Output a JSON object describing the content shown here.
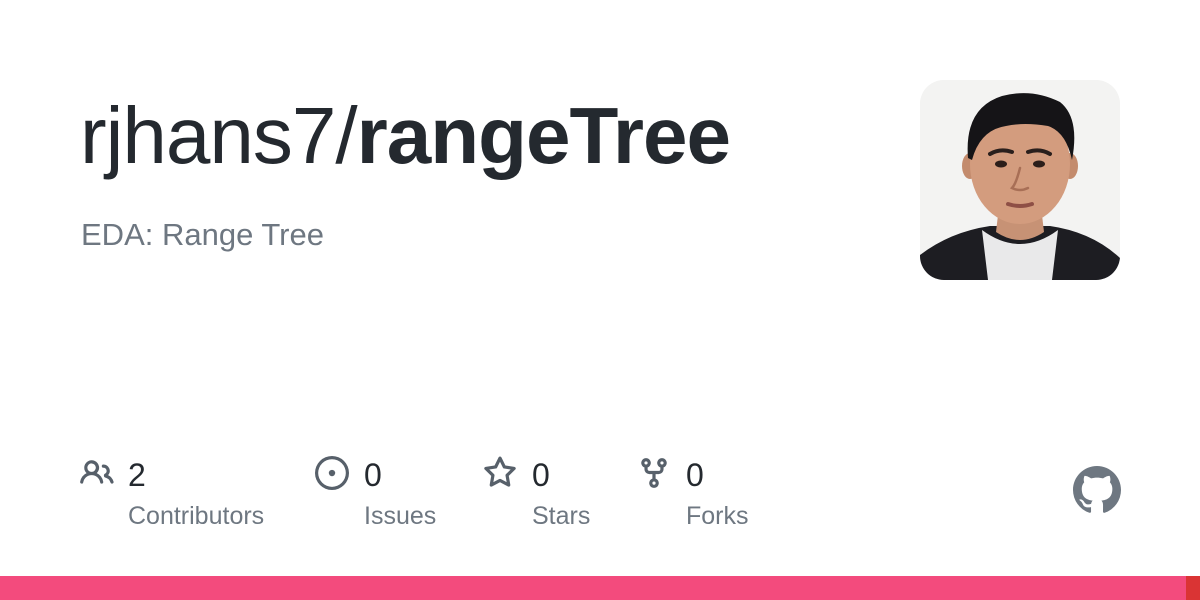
{
  "repo": {
    "owner": "rjhans7/",
    "name": "rangeTree",
    "description": "EDA: Range Tree"
  },
  "stats": [
    {
      "icon": "people-icon",
      "value": "2",
      "label": "Contributors"
    },
    {
      "icon": "issue-opened-icon",
      "value": "0",
      "label": "Issues"
    },
    {
      "icon": "star-icon",
      "value": "0",
      "label": "Stars"
    },
    {
      "icon": "repo-forked-icon",
      "value": "0",
      "label": "Forks"
    }
  ],
  "colors": {
    "text_primary": "#24292f",
    "text_secondary": "#6e7781",
    "icon": "#57606a",
    "github_logo": "#6e7781",
    "language_bar": [
      "#f34b7d",
      "#da3434"
    ]
  },
  "language_bar": [
    {
      "color": "#f34b7d",
      "fraction": 0.988
    },
    {
      "color": "#da3434",
      "fraction": 0.012
    }
  ]
}
